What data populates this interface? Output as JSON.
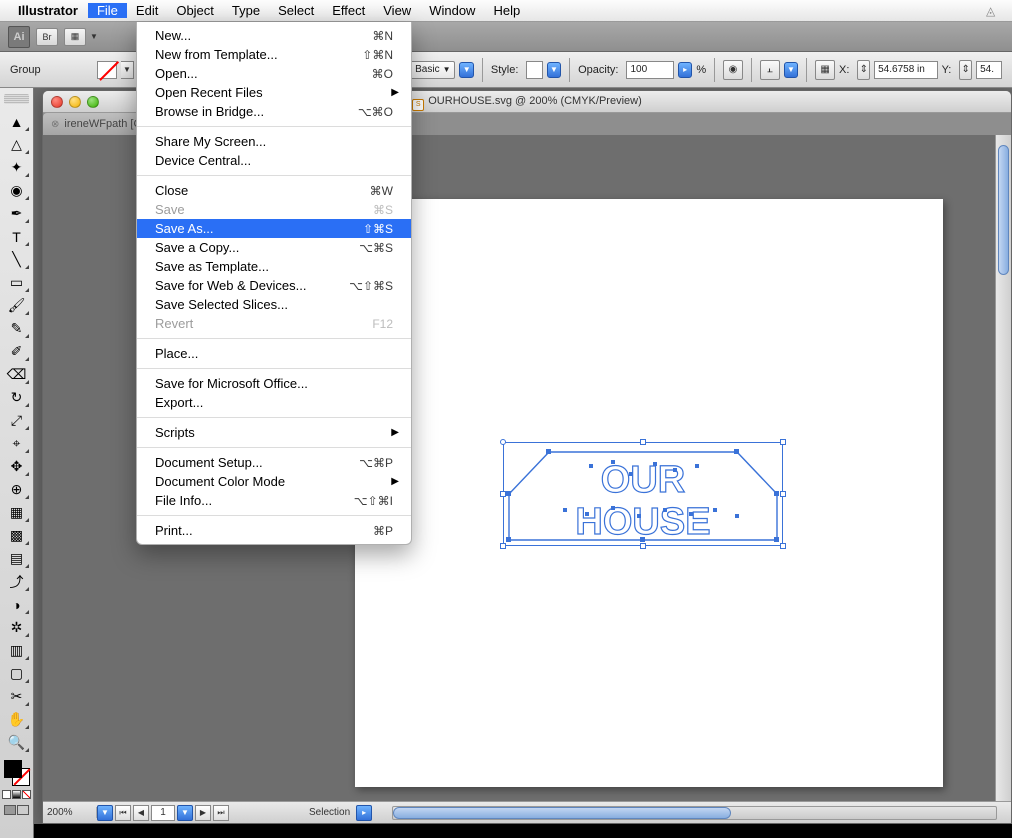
{
  "menubar": {
    "app": "Illustrator",
    "items": [
      "File",
      "Edit",
      "Object",
      "Type",
      "Select",
      "Effect",
      "View",
      "Window",
      "Help"
    ],
    "open_index": 0
  },
  "appbar": {
    "logo": "Ai",
    "br": "Br"
  },
  "controlbar": {
    "context": "Group",
    "basic": "Basic",
    "style_label": "Style:",
    "opacity_label": "Opacity:",
    "opacity_value": "100",
    "pct_arrow": "%",
    "x_label": "X:",
    "x_value": "54.6758 in",
    "y_label": "Y:",
    "y_value": "54."
  },
  "doc": {
    "title": "OURHOUSE.svg @ 200% (CMYK/Preview)",
    "tabs": [
      {
        "label": "ireneWFpath [C",
        "active": false
      },
      {
        "label": "E.svg @ 200% (CMYK/Preview)",
        "active": true
      }
    ],
    "status": {
      "zoom": "200%",
      "page": "1",
      "mode": "Selection"
    },
    "art": {
      "line1": "OUR",
      "line2": "HOUSE"
    }
  },
  "file_menu": [
    {
      "label": "New...",
      "shortcut": "⌘N"
    },
    {
      "label": "New from Template...",
      "shortcut": "⇧⌘N"
    },
    {
      "label": "Open...",
      "shortcut": "⌘O"
    },
    {
      "label": "Open Recent Files",
      "submenu": true
    },
    {
      "label": "Browse in Bridge...",
      "shortcut": "⌥⌘O"
    },
    {
      "divider": true
    },
    {
      "label": "Share My Screen..."
    },
    {
      "label": "Device Central..."
    },
    {
      "divider": true
    },
    {
      "label": "Close",
      "shortcut": "⌘W"
    },
    {
      "label": "Save",
      "shortcut": "⌘S",
      "disabled": true
    },
    {
      "label": "Save As...",
      "shortcut": "⇧⌘S",
      "highlight": true
    },
    {
      "label": "Save a Copy...",
      "shortcut": "⌥⌘S"
    },
    {
      "label": "Save as Template..."
    },
    {
      "label": "Save for Web & Devices...",
      "shortcut": "⌥⇧⌘S"
    },
    {
      "label": "Save Selected Slices..."
    },
    {
      "label": "Revert",
      "shortcut": "F12",
      "disabled": true
    },
    {
      "divider": true
    },
    {
      "label": "Place..."
    },
    {
      "divider": true
    },
    {
      "label": "Save for Microsoft Office..."
    },
    {
      "label": "Export..."
    },
    {
      "divider": true
    },
    {
      "label": "Scripts",
      "submenu": true
    },
    {
      "divider": true
    },
    {
      "label": "Document Setup...",
      "shortcut": "⌥⌘P"
    },
    {
      "label": "Document Color Mode",
      "submenu": true
    },
    {
      "label": "File Info...",
      "shortcut": "⌥⇧⌘I"
    },
    {
      "divider": true
    },
    {
      "label": "Print...",
      "shortcut": "⌘P"
    }
  ],
  "tools": [
    "selection",
    "direct-selection",
    "magic-wand",
    "lasso",
    "pen",
    "type",
    "line",
    "rectangle",
    "paintbrush",
    "pencil",
    "blob-brush",
    "eraser",
    "rotate",
    "scale",
    "width",
    "free-transform",
    "shape-builder",
    "perspective",
    "mesh",
    "gradient",
    "eyedropper",
    "blend",
    "symbol-sprayer",
    "column-graph",
    "artboard",
    "slice",
    "hand",
    "zoom"
  ]
}
